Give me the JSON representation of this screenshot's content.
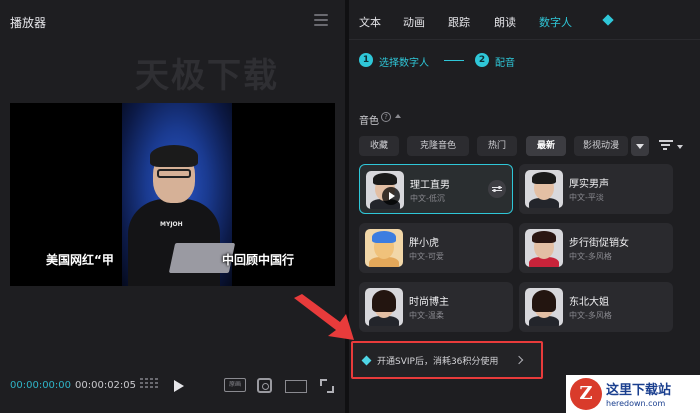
{
  "player": {
    "title": "播放器",
    "watermark": "天极下载",
    "subtitle_left": "美国网红“甲",
    "subtitle_right": "中回顾中国行",
    "shirt_logo": "MYJOH",
    "time_current": "00:00:00:00",
    "time_total": "00:00:02:05",
    "quality_label": "原画"
  },
  "tabs": [
    {
      "label": "文本",
      "active": false
    },
    {
      "label": "动画",
      "active": false
    },
    {
      "label": "跟踪",
      "active": false
    },
    {
      "label": "朗读",
      "active": false
    },
    {
      "label": "数字人",
      "active": true
    }
  ],
  "steps": [
    {
      "num": "1",
      "label": "选择数字人"
    },
    {
      "num": "2",
      "label": "配音"
    }
  ],
  "voice": {
    "header": "音色",
    "help_glyph": "?",
    "chips": [
      {
        "label": "收藏",
        "active": false
      },
      {
        "label": "克隆音色",
        "active": false
      },
      {
        "label": "热门",
        "active": false
      },
      {
        "label": "最新",
        "active": true
      },
      {
        "label": "影视动漫",
        "active": false
      }
    ]
  },
  "cards": [
    {
      "name": "理工直男",
      "desc": "中文-低沉",
      "selected": true,
      "avatar": "man-glasses"
    },
    {
      "name": "厚实男声",
      "desc": "中文-平淡",
      "selected": false,
      "avatar": "man-suit"
    },
    {
      "name": "胖小虎",
      "desc": "中文-可爱",
      "selected": false,
      "avatar": "cartoon-boy"
    },
    {
      "name": "步行街促销女",
      "desc": "中文-多风格",
      "selected": false,
      "avatar": "woman-red"
    },
    {
      "name": "时尚博主",
      "desc": "中文-温柔",
      "selected": false,
      "avatar": "woman-longhair"
    },
    {
      "name": "东北大姐",
      "desc": "中文-多风格",
      "selected": false,
      "avatar": "woman-smile"
    }
  ],
  "vip": {
    "text": "开通SVIP后，消耗36积分使用"
  },
  "site": {
    "logo_letter": "Z",
    "name": "这里下载站",
    "url": "heredown.com"
  },
  "colors": {
    "accent": "#2fc7d8",
    "highlight": "#e83b3b"
  }
}
